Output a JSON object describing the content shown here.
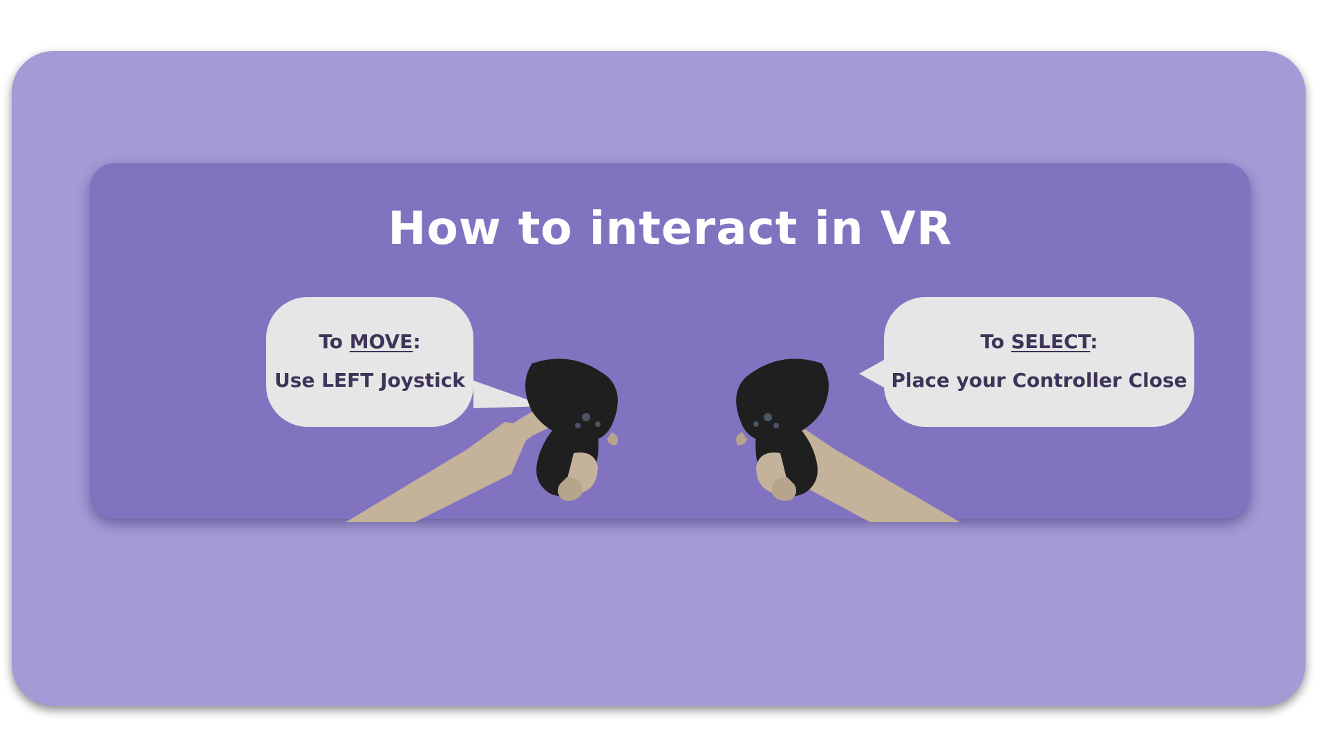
{
  "title": "How to interact in VR",
  "left_bubble": {
    "prefix": "To ",
    "action": "MOVE",
    "suffix": ":",
    "instruction": "Use LEFT Joystick"
  },
  "right_bubble": {
    "prefix": "To ",
    "action": "SELECT",
    "suffix": ":",
    "instruction": "Place your Controller Close"
  },
  "colors": {
    "outer_panel": "#a29bd6",
    "inner_card": "#8273c0",
    "bubble": "#e6e6e6",
    "bubble_text": "#3e3358",
    "title_text": "#ffffff",
    "controller": "#1e1e1e",
    "hand": "#c4b29a"
  },
  "icons": {
    "left": "left-hand-controller-icon",
    "right": "right-hand-controller-icon"
  }
}
